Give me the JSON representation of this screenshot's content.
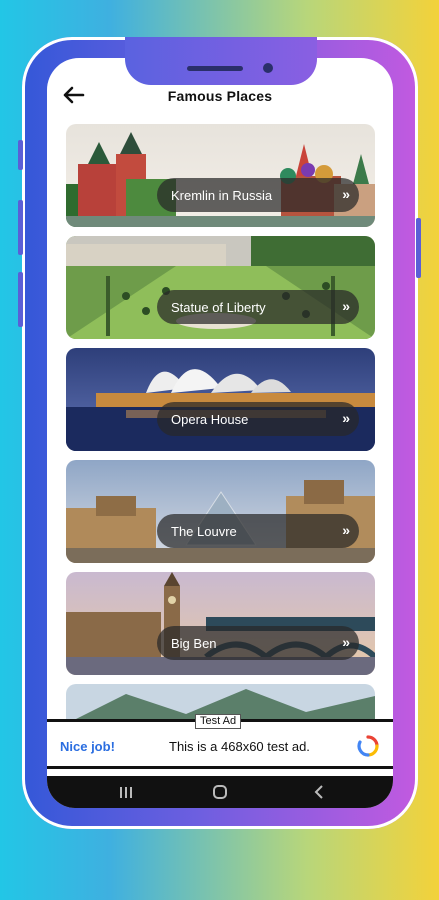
{
  "appbar": {
    "title": "Famous Places",
    "back_icon": "arrow-left-icon"
  },
  "places": [
    {
      "label": "Kremlin in Russia",
      "arrow": "»"
    },
    {
      "label": "Statue of Liberty",
      "arrow": "»"
    },
    {
      "label": "Opera House",
      "arrow": "»"
    },
    {
      "label": "The Louvre",
      "arrow": "»"
    },
    {
      "label": "Big Ben",
      "arrow": "»"
    }
  ],
  "ad": {
    "tag": "Test Ad",
    "nice": "Nice job!",
    "text": "This is a 468x60 test ad.",
    "logo_icon": "ad-logo-icon",
    "colors": {
      "blue": "#4285f4",
      "red": "#ea4335",
      "yellow": "#fbbc04"
    }
  },
  "navbar": {
    "icons": [
      "recent-apps-icon",
      "home-icon",
      "back-icon"
    ]
  },
  "colors": {
    "phone_left": "#3458d8",
    "phone_right": "#c25ae0",
    "pill_bg": "#282828"
  }
}
